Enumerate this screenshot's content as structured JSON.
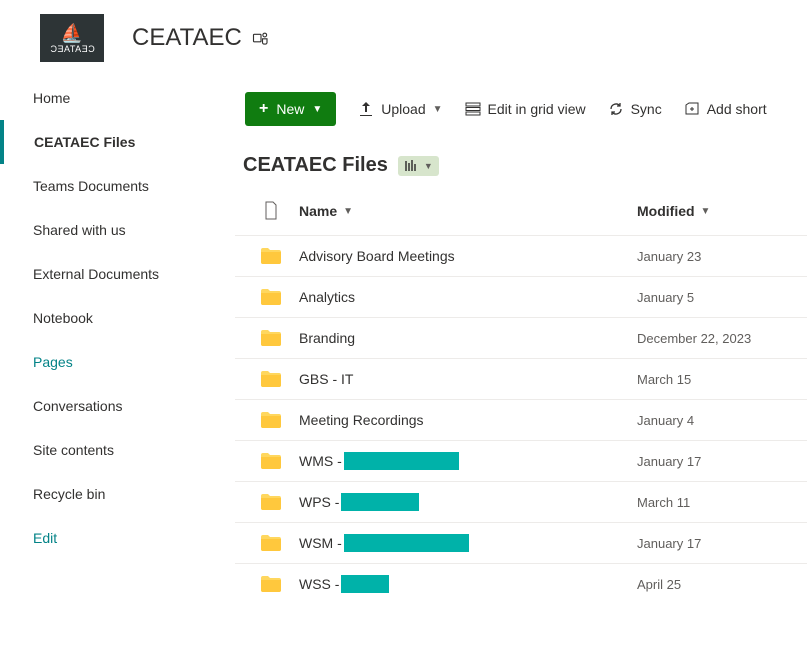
{
  "site": {
    "title": "CEATAEC",
    "logo_text": "CEATAEC"
  },
  "nav": {
    "items": [
      {
        "label": "Home"
      },
      {
        "label": "CEATAEC Files"
      },
      {
        "label": "Teams Documents"
      },
      {
        "label": "Shared with us"
      },
      {
        "label": "External Documents"
      },
      {
        "label": "Notebook"
      },
      {
        "label": "Pages"
      },
      {
        "label": "Conversations"
      },
      {
        "label": "Site contents"
      },
      {
        "label": "Recycle bin"
      },
      {
        "label": "Edit"
      }
    ]
  },
  "toolbar": {
    "new_label": "New",
    "upload_label": "Upload",
    "grid_label": "Edit in grid view",
    "sync_label": "Sync",
    "shortcut_label": "Add short"
  },
  "library": {
    "title": "CEATAEC Files",
    "columns": {
      "name": "Name",
      "modified": "Modified"
    },
    "rows": [
      {
        "name": "Advisory Board Meetings",
        "modified": "January 23",
        "redacted": false
      },
      {
        "name": "Analytics",
        "modified": "January 5",
        "redacted": false
      },
      {
        "name": "Branding",
        "modified": "December 22, 2023",
        "redacted": false
      },
      {
        "name": "GBS - IT",
        "modified": "March 15",
        "redacted": false
      },
      {
        "name": "Meeting Recordings",
        "modified": "January 4",
        "redacted": false
      },
      {
        "name": "WMS - ",
        "modified": "January 17",
        "redacted": true,
        "redact_w": 115
      },
      {
        "name": "WPS - ",
        "modified": "March 11",
        "redacted": true,
        "redact_w": 78
      },
      {
        "name": "WSM - ",
        "modified": "January 17",
        "redacted": true,
        "redact_w": 125
      },
      {
        "name": "WSS - ",
        "modified": "April 25",
        "redacted": true,
        "redact_w": 48
      }
    ]
  }
}
